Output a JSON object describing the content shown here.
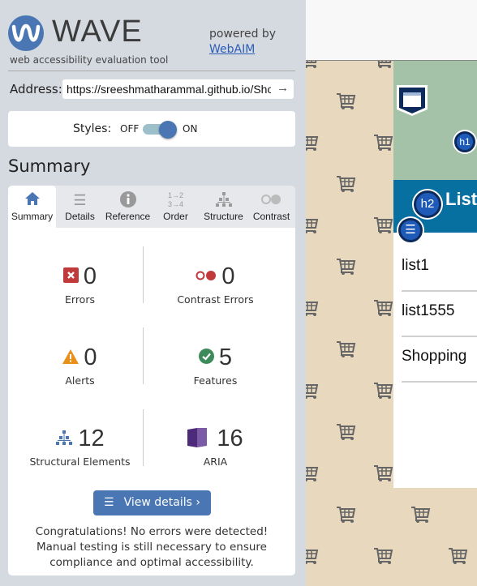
{
  "wave": {
    "logo_text": "WAVE",
    "tagline": "web accessibility evaluation tool",
    "powered_by": "powered by",
    "webaim_link": "WebAIM",
    "address_label": "Address:",
    "address_value": "https://sreeshmatharammal.github.io/Shop:",
    "styles_label": "Styles:",
    "styles_off": "OFF",
    "styles_on": "ON",
    "styles_enabled": true,
    "summary_heading": "Summary",
    "tabs": [
      {
        "label": "Summary",
        "icon": "home-icon",
        "active": true
      },
      {
        "label": "Details",
        "icon": "list-icon"
      },
      {
        "label": "Reference",
        "icon": "info-icon"
      },
      {
        "label": "Order",
        "icon": "order-icon"
      },
      {
        "label": "Structure",
        "icon": "structure-icon"
      },
      {
        "label": "Contrast",
        "icon": "contrast-icon"
      }
    ],
    "stats": {
      "errors": {
        "value": "0",
        "label": "Errors",
        "color": "#c0393b"
      },
      "contrast_errors": {
        "value": "0",
        "label": "Contrast Errors",
        "color": "#c0393b"
      },
      "alerts": {
        "value": "0",
        "label": "Alerts",
        "color": "#e8901a"
      },
      "features": {
        "value": "5",
        "label": "Features",
        "color": "#3d8b5a"
      },
      "structural": {
        "value": "12",
        "label": "Structural Elements",
        "color": "#4a76b4"
      },
      "aria": {
        "value": "16",
        "label": "ARIA",
        "color": "#4e2a7a"
      }
    },
    "view_details": "View details ›",
    "congrats": "Congratulations! No errors were detected! Manual testing is still necessary to ensure compliance and optimal accessibility."
  },
  "site": {
    "h1_badge": "h1",
    "h2_badge": "h2",
    "band_text": "List",
    "list_items": [
      "list1",
      "list1555",
      "Shopping"
    ],
    "header_color": "#a3c2a8",
    "band_color": "#0870a0",
    "background_color": "#e8d8bd"
  }
}
